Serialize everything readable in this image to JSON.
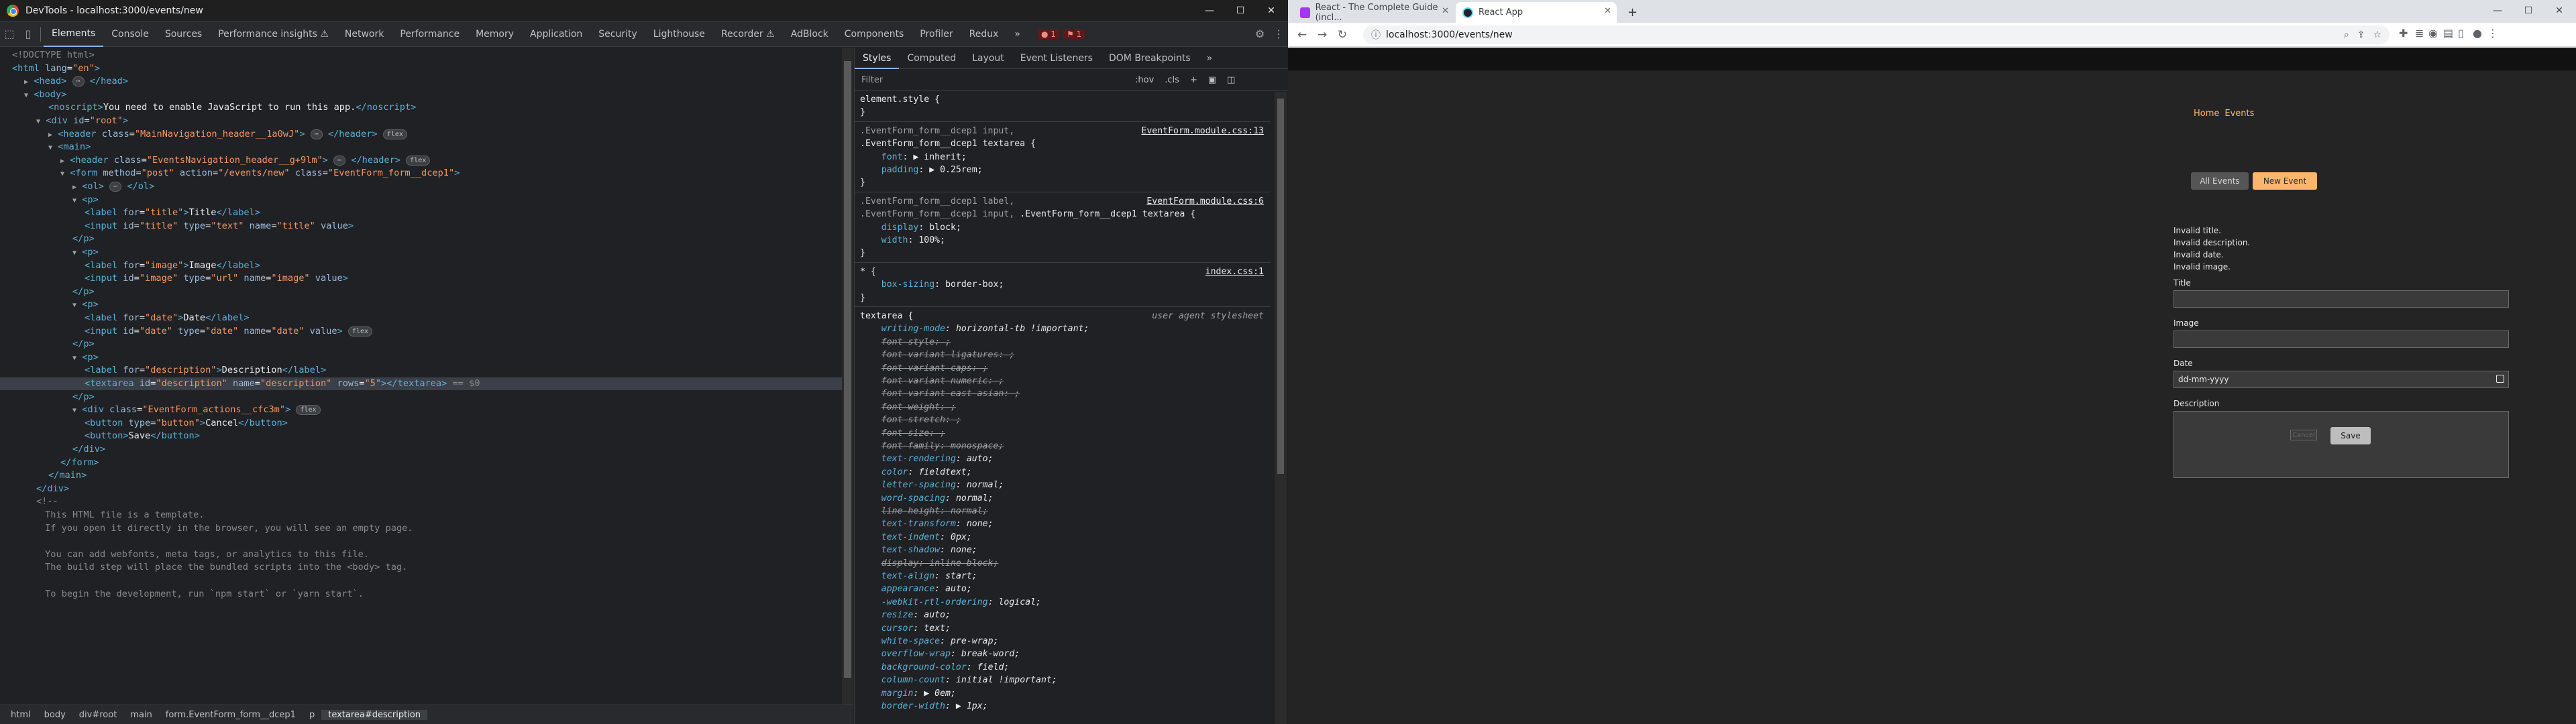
{
  "devtools": {
    "window_title": "DevTools - localhost:3000/events/new",
    "tabs": [
      "Elements",
      "Console",
      "Sources",
      "Performance insights ⚠",
      "Network",
      "Performance",
      "Memory",
      "Application",
      "Security",
      "Lighthouse",
      "Recorder ⚠",
      "AdBlock",
      "Components",
      "Profiler",
      "Redux",
      "»"
    ],
    "error_count": "1",
    "warn_count": "1",
    "elements_lines": [
      {
        "indent": 0,
        "html": "<span class='cmt'>&lt;!DOCTYPE html&gt;</span>"
      },
      {
        "indent": 0,
        "html": "<span class='tag'>&lt;html</span> <span class='attr'>lang</span>=<span class='val'>\"en\"</span><span class='tag'>&gt;</span>"
      },
      {
        "indent": 1,
        "html": "<span class='arrow'>▶</span> <span class='tag'>&lt;head&gt;</span> <span class='pill'>⋯</span> <span class='tag'>&lt;/head&gt;</span>"
      },
      {
        "indent": 1,
        "html": "<span class='arrow'>▼</span> <span class='tag'>&lt;body&gt;</span>"
      },
      {
        "indent": 3,
        "html": "<span class='tag'>&lt;noscript&gt;</span><span class='txt'>You need to enable JavaScript to run this app.</span><span class='tag'>&lt;/noscript&gt;</span>"
      },
      {
        "indent": 2,
        "html": "<span class='arrow'>▼</span> <span class='tag'>&lt;div</span> <span class='attr'>id</span>=<span class='val'>\"root\"</span><span class='tag'>&gt;</span>"
      },
      {
        "indent": 3,
        "html": "<span class='arrow'>▶</span> <span class='tag'>&lt;header</span> <span class='attr'>class</span>=<span class='val'>\"MainNavigation_header__1a0wJ\"</span><span class='tag'>&gt;</span> <span class='pill'>⋯</span> <span class='tag'>&lt;/header&gt;</span> <span class='pill'>flex</span>"
      },
      {
        "indent": 3,
        "html": "<span class='arrow'>▼</span> <span class='tag'>&lt;main&gt;</span>"
      },
      {
        "indent": 4,
        "html": "<span class='arrow'>▶</span> <span class='tag'>&lt;header</span> <span class='attr'>class</span>=<span class='val'>\"EventsNavigation_header__g+9lm\"</span><span class='tag'>&gt;</span> <span class='pill'>⋯</span> <span class='tag'>&lt;/header&gt;</span> <span class='pill'>flex</span>"
      },
      {
        "indent": 4,
        "html": "<span class='arrow'>▼</span> <span class='tag'>&lt;form</span> <span class='attr'>method</span>=<span class='val'>\"post\"</span> <span class='attr'>action</span>=<span class='val'>\"/events/new\"</span> <span class='attr'>class</span>=<span class='val'>\"EventForm_form__dcep1\"</span><span class='tag'>&gt;</span>"
      },
      {
        "indent": 5,
        "html": "<span class='arrow'>▶</span> <span class='tag'>&lt;ol&gt;</span> <span class='pill'>⋯</span> <span class='tag'>&lt;/ol&gt;</span>"
      },
      {
        "indent": 5,
        "html": "<span class='arrow'>▼</span> <span class='tag'>&lt;p&gt;</span>"
      },
      {
        "indent": 6,
        "html": "<span class='tag'>&lt;label</span> <span class='attr'>for</span>=<span class='val'>\"title\"</span><span class='tag'>&gt;</span><span class='txt'>Title</span><span class='tag'>&lt;/label&gt;</span>"
      },
      {
        "indent": 6,
        "html": "<span class='tag'>&lt;input</span> <span class='attr'>id</span>=<span class='val'>\"title\"</span> <span class='attr'>type</span>=<span class='val'>\"text\"</span> <span class='attr'>name</span>=<span class='val'>\"title\"</span> <span class='attr'>value</span><span class='tag'>&gt;</span>"
      },
      {
        "indent": 5,
        "html": "<span class='tag'>&lt;/p&gt;</span>"
      },
      {
        "indent": 5,
        "html": "<span class='arrow'>▼</span> <span class='tag'>&lt;p&gt;</span>"
      },
      {
        "indent": 6,
        "html": "<span class='tag'>&lt;label</span> <span class='attr'>for</span>=<span class='val'>\"image\"</span><span class='tag'>&gt;</span><span class='txt'>Image</span><span class='tag'>&lt;/label&gt;</span>"
      },
      {
        "indent": 6,
        "html": "<span class='tag'>&lt;input</span> <span class='attr'>id</span>=<span class='val'>\"image\"</span> <span class='attr'>type</span>=<span class='val'>\"url\"</span> <span class='attr'>name</span>=<span class='val'>\"image\"</span> <span class='attr'>value</span><span class='tag'>&gt;</span>"
      },
      {
        "indent": 5,
        "html": "<span class='tag'>&lt;/p&gt;</span>"
      },
      {
        "indent": 5,
        "html": "<span class='arrow'>▼</span> <span class='tag'>&lt;p&gt;</span>"
      },
      {
        "indent": 6,
        "html": "<span class='tag'>&lt;label</span> <span class='attr'>for</span>=<span class='val'>\"date\"</span><span class='tag'>&gt;</span><span class='txt'>Date</span><span class='tag'>&lt;/label&gt;</span>"
      },
      {
        "indent": 6,
        "html": "<span class='tag'>&lt;input</span> <span class='attr'>id</span>=<span class='val'>\"date\"</span> <span class='attr'>type</span>=<span class='val'>\"date\"</span> <span class='attr'>name</span>=<span class='val'>\"date\"</span> <span class='attr'>value</span><span class='tag'>&gt;</span> <span class='pill'>flex</span>"
      },
      {
        "indent": 5,
        "html": "<span class='tag'>&lt;/p&gt;</span>"
      },
      {
        "indent": 5,
        "html": "<span class='arrow'>▼</span> <span class='tag'>&lt;p&gt;</span>"
      },
      {
        "indent": 6,
        "html": "<span class='tag'>&lt;label</span> <span class='attr'>for</span>=<span class='val'>\"description\"</span><span class='tag'>&gt;</span><span class='txt'>Description</span><span class='tag'>&lt;/label&gt;</span>"
      },
      {
        "indent": 6,
        "html": "<span class='tag'>&lt;textarea</span> <span class='attr'>id</span>=<span class='val'>\"description\"</span> <span class='attr'>name</span>=<span class='val'>\"description\"</span> <span class='attr'>rows</span>=<span class='val'>\"5\"</span><span class='tag'>&gt;&lt;/textarea&gt;</span> <span class='cmt'>== $0</span>",
        "selected": true
      },
      {
        "indent": 5,
        "html": "<span class='tag'>&lt;/p&gt;</span>"
      },
      {
        "indent": 5,
        "html": "<span class='arrow'>▼</span> <span class='tag'>&lt;div</span> <span class='attr'>class</span>=<span class='val'>\"EventForm_actions__cfc3m\"</span><span class='tag'>&gt;</span> <span class='pill'>flex</span>"
      },
      {
        "indent": 6,
        "html": "<span class='tag'>&lt;button</span> <span class='attr'>type</span>=<span class='val'>\"button\"</span><span class='tag'>&gt;</span><span class='txt'>Cancel</span><span class='tag'>&lt;/button&gt;</span>"
      },
      {
        "indent": 6,
        "html": "<span class='tag'>&lt;button&gt;</span><span class='txt'>Save</span><span class='tag'>&lt;/button&gt;</span>"
      },
      {
        "indent": 5,
        "html": "<span class='tag'>&lt;/div&gt;</span>"
      },
      {
        "indent": 4,
        "html": "<span class='tag'>&lt;/form&gt;</span>"
      },
      {
        "indent": 3,
        "html": "<span class='tag'>&lt;/main&gt;</span>"
      },
      {
        "indent": 2,
        "html": "<span class='tag'>&lt;/div&gt;</span>"
      },
      {
        "indent": 2,
        "html": "<span class='cmt'>&lt;!--</span>"
      },
      {
        "indent": 0,
        "html": "<span class='cmt'>      This HTML file is a template.</span>"
      },
      {
        "indent": 0,
        "html": "<span class='cmt'>      If you open it directly in the browser, you will see an empty page.</span>"
      },
      {
        "indent": 0,
        "html": ""
      },
      {
        "indent": 0,
        "html": "<span class='cmt'>      You can add webfonts, meta tags, or analytics to this file.</span>"
      },
      {
        "indent": 0,
        "html": "<span class='cmt'>      The build step will place the bundled scripts into the &lt;body&gt; tag.</span>"
      },
      {
        "indent": 0,
        "html": ""
      },
      {
        "indent": 0,
        "html": "<span class='cmt'>      To begin the development, run `npm start` or `yarn start`.</span>"
      }
    ],
    "breadcrumbs": [
      "html",
      "body",
      "div#root",
      "main",
      "form.EventForm_form__dcep1",
      "p",
      "textarea#description"
    ],
    "styles": {
      "sub_tabs": [
        "Styles",
        "Computed",
        "Layout",
        "Event Listeners",
        "DOM Breakpoints",
        "»"
      ],
      "filter_placeholder": "Filter",
      "filter_buttons": [
        ":hov",
        ".cls",
        "+"
      ],
      "rules": [
        {
          "kind": "plain",
          "html": "<span class='sel-txt'>element.style {</span>"
        },
        {
          "kind": "plain",
          "html": "<span class='sel-txt'>}</span>"
        },
        {
          "kind": "sep"
        },
        {
          "kind": "src",
          "html": "<span class='sel-dim'>.EventForm_form__dcep1 input,</span>",
          "src": "EventForm.module.css:13"
        },
        {
          "kind": "plain",
          "html": "<span class='sel-txt'>.EventForm_form__dcep1 textarea {</span>"
        },
        {
          "kind": "plain",
          "html": "    <span class='prop'>font</span>: ▶ <span class='pval'>inherit</span>;"
        },
        {
          "kind": "plain",
          "html": "    <span class='prop'>padding</span>: ▶ <span class='pval'>0.25rem</span>;"
        },
        {
          "kind": "plain",
          "html": "<span class='sel-txt'>}</span>"
        },
        {
          "kind": "sep"
        },
        {
          "kind": "src",
          "html": "<span class='sel-dim'>.EventForm_form__dcep1 label,</span>",
          "src": "EventForm.module.css:6"
        },
        {
          "kind": "plain",
          "html": "<span class='sel-dim'>.EventForm_form__dcep1 input,</span> <span class='sel-txt'>.EventForm_form__dcep1 textarea {</span>"
        },
        {
          "kind": "plain",
          "html": "    <span class='prop'>display</span>: <span class='pval'>block</span>;"
        },
        {
          "kind": "plain",
          "html": "    <span class='prop'>width</span>: <span class='pval'>100%</span>;"
        },
        {
          "kind": "plain",
          "html": "<span class='sel-txt'>}</span>"
        },
        {
          "kind": "sep"
        },
        {
          "kind": "src",
          "html": "<span class='sel-txt'>* {</span>",
          "src": "index.css:1"
        },
        {
          "kind": "plain",
          "html": "    <span class='prop'>box-sizing</span>: <span class='pval'>border-box</span>;"
        },
        {
          "kind": "plain",
          "html": "<span class='sel-txt'>}</span>"
        },
        {
          "kind": "sep"
        },
        {
          "kind": "ua",
          "html": "<span class='sel-txt'>textarea {</span>",
          "src": "user agent stylesheet"
        },
        {
          "kind": "plain",
          "html": "    <i><span class='prop'>writing-mode</span>: <span class='pval'>horizontal-tb !important</span>;</i>"
        },
        {
          "kind": "plain",
          "html": "    <i class='strike'>font-style: ;</i>"
        },
        {
          "kind": "plain",
          "html": "    <i class='strike'>font-variant-ligatures: ;</i>"
        },
        {
          "kind": "plain",
          "html": "    <i class='strike'>font-variant-caps: ;</i>"
        },
        {
          "kind": "plain",
          "html": "    <i class='strike'>font-variant-numeric: ;</i>"
        },
        {
          "kind": "plain",
          "html": "    <i class='strike'>font-variant-east-asian: ;</i>"
        },
        {
          "kind": "plain",
          "html": "    <i class='strike'>font-weight: ;</i>"
        },
        {
          "kind": "plain",
          "html": "    <i class='strike'>font-stretch: ;</i>"
        },
        {
          "kind": "plain",
          "html": "    <i class='strike'>font-size: ;</i>"
        },
        {
          "kind": "plain",
          "html": "    <i class='strike'>font-family: monospace;</i>"
        },
        {
          "kind": "plain",
          "html": "    <i><span class='prop'>text-rendering</span>: <span class='pval'>auto</span>;</i>"
        },
        {
          "kind": "plain",
          "html": "    <i><span class='prop'>color</span>: <span class='pval'>fieldtext</span>;</i>"
        },
        {
          "kind": "plain",
          "html": "    <i><span class='prop'>letter-spacing</span>: <span class='pval'>normal</span>;</i>"
        },
        {
          "kind": "plain",
          "html": "    <i><span class='prop'>word-spacing</span>: <span class='pval'>normal</span>;</i>"
        },
        {
          "kind": "plain",
          "html": "    <i class='strike'>line-height: normal;</i>"
        },
        {
          "kind": "plain",
          "html": "    <i><span class='prop'>text-transform</span>: <span class='pval'>none</span>;</i>"
        },
        {
          "kind": "plain",
          "html": "    <i><span class='prop'>text-indent</span>: <span class='pval'>0px</span>;</i>"
        },
        {
          "kind": "plain",
          "html": "    <i><span class='prop'>text-shadow</span>: <span class='pval'>none</span>;</i>"
        },
        {
          "kind": "plain",
          "html": "    <i class='strike'>display: inline-block;</i>"
        },
        {
          "kind": "plain",
          "html": "    <i><span class='prop'>text-align</span>: <span class='pval'>start</span>;</i>"
        },
        {
          "kind": "plain",
          "html": "    <i><span class='prop'>appearance</span>: <span class='pval'>auto</span>;</i>"
        },
        {
          "kind": "plain",
          "html": "    <i><span class='prop'>-webkit-rtl-ordering</span>: <span class='pval'>logical</span>;</i>"
        },
        {
          "kind": "plain",
          "html": "    <i><span class='prop'>resize</span>: <span class='pval'>auto</span>;</i>"
        },
        {
          "kind": "plain",
          "html": "    <i><span class='prop'>cursor</span>: <span class='pval'>text</span>;</i>"
        },
        {
          "kind": "plain",
          "html": "    <i><span class='prop'>white-space</span>: <span class='pval'>pre-wrap</span>;</i>"
        },
        {
          "kind": "plain",
          "html": "    <i><span class='prop'>overflow-wrap</span>: <span class='pval'>break-word</span>;</i>"
        },
        {
          "kind": "plain",
          "html": "    <i><span class='prop'>background-color</span>: <span class='pval'>field</span>;</i>"
        },
        {
          "kind": "plain",
          "html": "    <i><span class='prop'>column-count</span>: <span class='pval'>initial !important</span>;</i>"
        },
        {
          "kind": "plain",
          "html": "    <i><span class='prop'>margin</span>: ▶ <span class='pval'>0em</span>;</i>"
        },
        {
          "kind": "plain",
          "html": "    <i><span class='prop'>border-width</span>: ▶ <span class='pval'>1px</span>;</i>"
        }
      ]
    }
  },
  "browser": {
    "tabs": [
      {
        "title": "React - The Complete Guide (incl...",
        "color": "#a435f0",
        "active": false
      },
      {
        "title": "React App",
        "color": "#20232a",
        "active": true
      }
    ],
    "new_tab_label": "+",
    "url": "localhost:3000/events/new",
    "page": {
      "nav_links": [
        {
          "label": "Home",
          "active": false
        },
        {
          "label": "Events",
          "active": false
        }
      ],
      "event_buttons": {
        "all": "All Events",
        "new": "New Event"
      },
      "errors": [
        "Invalid title.",
        "Invalid description.",
        "Invalid date.",
        "Invalid image."
      ],
      "fields": {
        "title_label": "Title",
        "image_label": "Image",
        "date_label": "Date",
        "date_placeholder": "dd-mm-yyyy",
        "description_label": "Description"
      },
      "actions": {
        "cancel": "Cancel",
        "save": "Save"
      }
    }
  }
}
